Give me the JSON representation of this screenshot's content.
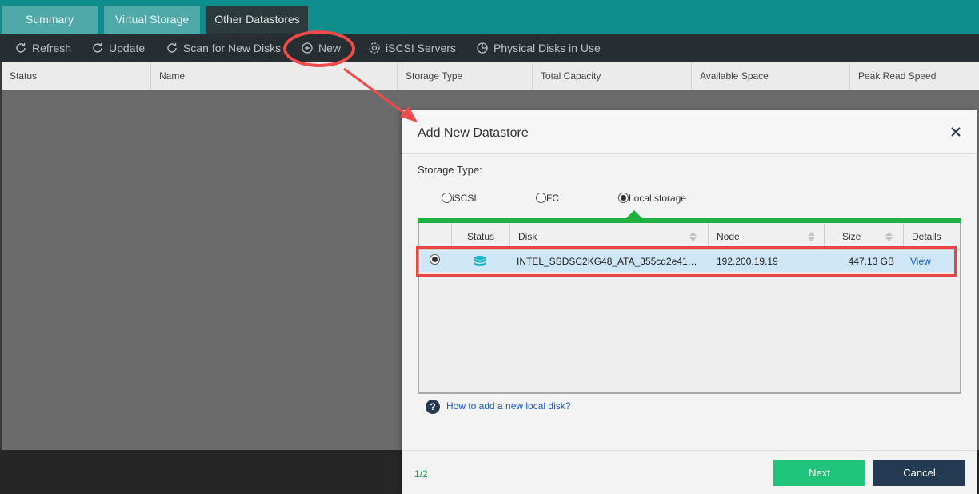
{
  "tabs": [
    {
      "label": "Summary"
    },
    {
      "label": "Virtual Storage"
    },
    {
      "label": "Other Datastores"
    }
  ],
  "toolbar": {
    "refresh": "Refresh",
    "update": "Update",
    "scan": "Scan for New Disks",
    "new": "New",
    "iscsi_servers": "iSCSI Servers",
    "physical_disks": "Physical Disks in Use"
  },
  "grid": {
    "columns": [
      "Status",
      "Name",
      "Storage Type",
      "Total Capacity",
      "Available Space",
      "Peak Read Speed"
    ]
  },
  "dialog": {
    "title": "Add New Datastore",
    "storage_type_label": "Storage Type:",
    "options": [
      {
        "label": "iSCSI",
        "selected": false
      },
      {
        "label": "FC",
        "selected": false
      },
      {
        "label": "Local storage",
        "selected": true
      }
    ],
    "table": {
      "headers": [
        "Status",
        "Disk",
        "Node",
        "Size",
        "Details"
      ],
      "rows": [
        {
          "selected": true,
          "status_icon": "database-icon",
          "disk": "INTEL_SSDSC2KG48_ATA_355cd2e41…",
          "node": "192.200.19.19",
          "size": "447.13 GB",
          "details": "View"
        }
      ]
    },
    "help": "How to add a new local disk?",
    "pager": "1/2",
    "next": "Next",
    "cancel": "Cancel"
  },
  "colors": {
    "teal": "#0f8c8c",
    "green": "#1eb140",
    "next_button": "#20c37a",
    "cancel_button": "#233a52",
    "annotation_red": "#f04a4a"
  }
}
